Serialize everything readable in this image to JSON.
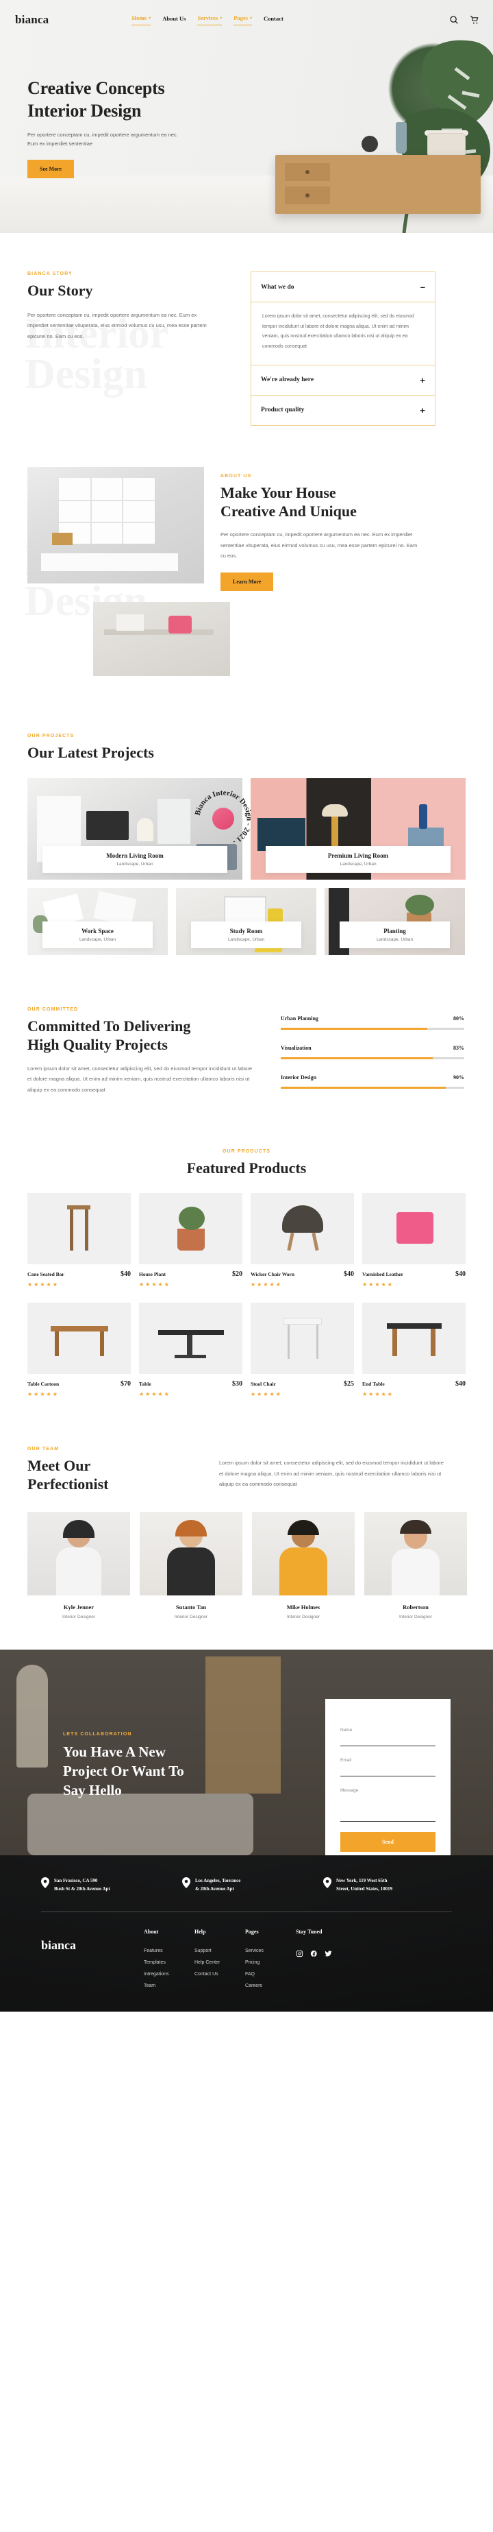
{
  "brand": "bianca",
  "nav": {
    "items": [
      {
        "label": "Home",
        "caret": true,
        "active": true
      },
      {
        "label": "About Us",
        "caret": false,
        "active": false
      },
      {
        "label": "Services",
        "caret": true,
        "active": true
      },
      {
        "label": "Pages",
        "caret": true,
        "active": true
      },
      {
        "label": "Contact",
        "caret": false,
        "active": false
      }
    ],
    "search_icon": "search-icon",
    "cart_icon": "cart-icon"
  },
  "hero": {
    "title_line1": "Creative Concepts",
    "title_line2": "Interior Design",
    "paragraph": "Per oportere conceptam cu, impedit oportere argumentum ea nec. Eum ex imperdiet sententiae",
    "cta": "See More"
  },
  "story": {
    "eyebrow": "BIANCA STORY",
    "title": "Our Story",
    "paragraph": "Per oportere conceptam cu, impedit oportere argumentum ea nec. Eum ex imperdiet sententiae vituperata, eius eirmod volumus cu usu, mea esse partem epicurei no. Eam cu eos.",
    "ghost_line1": "Interior",
    "ghost_line2": "Design",
    "accordion": [
      {
        "title": "What we do",
        "sign": "–",
        "open": true,
        "body": "Lorem ipsum dolor sit amet, consectetur adipiscing elit, sed do eiusmod tempor incididunt ut labore et dolore magna aliqua. Ut enim ad minim veniam, quis nostrud exercitation ullamco laboris nisi ut aliquip ex ea commodo consequat"
      },
      {
        "title": "We're already here",
        "sign": "+",
        "open": false,
        "body": ""
      },
      {
        "title": "Product quality",
        "sign": "+",
        "open": false,
        "body": ""
      }
    ]
  },
  "about": {
    "eyebrow": "ABOUT US",
    "title_line1": "Make Your House",
    "title_line2": "Creative And Unique",
    "paragraph": "Per oportere conceptam cu, impedit oportere argumentum ea nec. Eum ex imperdiet sententiae vituperata, eius eirmod volumus cu usu, mea esse partem epicurei no. Eam cu eos.",
    "cta": "Learn More",
    "ghost_line1": "Interior",
    "ghost_line2": "Design",
    "seal_text": "Bianca Interior Design - 2021 - "
  },
  "projects": {
    "eyebrow": "OUR PROJECTS",
    "title": "Our Latest Projects",
    "items": [
      {
        "name": "Modern Living Room",
        "tags": "Landscape, Urban",
        "size": "big"
      },
      {
        "name": "Premium Living Room",
        "tags": "Landscape, Urban",
        "size": "big"
      },
      {
        "name": "Work Space",
        "tags": "Landscape, Urban",
        "size": "small"
      },
      {
        "name": "Study Room",
        "tags": "Landscape, Urban",
        "size": "small"
      },
      {
        "name": "Planting",
        "tags": "Landscape, Urban",
        "size": "small"
      }
    ]
  },
  "committed": {
    "eyebrow": "OUR COMMITTED",
    "title_line1": "Committed To Delivering",
    "title_line2": "High Quality Projects",
    "paragraph": "Lorem ipsum dolor sit amet, consectetur adipiscing elit, sed do eiusmod tempor incididunt ut labore et dolore magna aliqua. Ut enim ad minim veniam, quis nostrud exercitation ullamco laboris nisi ut aliquip ex ea commodo consequat",
    "skills": [
      {
        "label": "Urban Planning",
        "value": "80%",
        "pct": 80
      },
      {
        "label": "Visualization",
        "value": "83%",
        "pct": 83
      },
      {
        "label": "Interior Design",
        "value": "90%",
        "pct": 90
      }
    ]
  },
  "products": {
    "eyebrow": "OUR PRODUCTS",
    "title": "Featured Products",
    "items": [
      {
        "name": "Cane Seated Bar",
        "price": "$40",
        "stars": "★★★★★"
      },
      {
        "name": "House Plant",
        "price": "$20",
        "stars": "★★★★★"
      },
      {
        "name": "Wicker Chair Worn",
        "price": "$40",
        "stars": "★★★★★"
      },
      {
        "name": "Varnished Leather",
        "price": "$40",
        "stars": "★★★★★"
      },
      {
        "name": "Table Cartoon",
        "price": "$70",
        "stars": "★★★★★"
      },
      {
        "name": "Table",
        "price": "$30",
        "stars": "★★★★★"
      },
      {
        "name": "Stool Chair",
        "price": "$25",
        "stars": "★★★★★"
      },
      {
        "name": "End Table",
        "price": "$40",
        "stars": "★★★★★"
      }
    ]
  },
  "team": {
    "eyebrow": "OUR TEAM",
    "title_line1": "Meet Our",
    "title_line2": "Perfectionist",
    "paragraph": "Lorem ipsum dolor sit amet, consectetur adipiscing elit, sed do eiusmod tempor incididunt ut labore et dolore magna aliqua. Ut enim ad minim veniam, quis nostrud exercitation ullamco laboris nisi ut aliquip ex ea commodo consequat",
    "members": [
      {
        "name": "Kyle Jenner",
        "role": "Interior Designer"
      },
      {
        "name": "Sutanto Tan",
        "role": "Interior Designer"
      },
      {
        "name": "Mike Holmes",
        "role": "Interior Designer"
      },
      {
        "name": "Robertson",
        "role": "Interior Designer"
      }
    ]
  },
  "contact": {
    "eyebrow": "LETS COLLABORATION",
    "title_line1": "You Have A New",
    "title_line2": "Project Or Want To",
    "title_line3": "Say Hello",
    "name_label": "Name",
    "name_value": "",
    "name_placeholder": "",
    "email_label": "Email",
    "email_value": "",
    "email_placeholder": "",
    "message_label": "Message",
    "message_value": "",
    "message_placeholder": "",
    "send": "Send"
  },
  "footer": {
    "brand": "bianca",
    "addresses": [
      {
        "line1": "San Frasisco, CA 590",
        "line2": "Bush St & 20th Avenue Apt"
      },
      {
        "line1": "Los Angeles, Torrance",
        "line2": "& 20th Avenue Apt"
      },
      {
        "line1": "New York, 119 West 65th",
        "line2": "Street, United States, 10019"
      }
    ],
    "columns": [
      {
        "title": "About",
        "links": [
          "Features",
          "Templates",
          "Intregations",
          "Team"
        ]
      },
      {
        "title": "Help",
        "links": [
          "Support",
          "Help Center",
          "Contact Us"
        ]
      },
      {
        "title": "Pages",
        "links": [
          "Services",
          "Pricing",
          "FAQ",
          "Careers"
        ]
      }
    ],
    "stay_tuned": "Stay Tuned",
    "socials": [
      "instagram-icon",
      "facebook-icon",
      "twitter-icon"
    ]
  },
  "colors": {
    "accent": "#f2a42b",
    "accent_light": "#eccf8e",
    "dark": "#1b1b1b"
  }
}
